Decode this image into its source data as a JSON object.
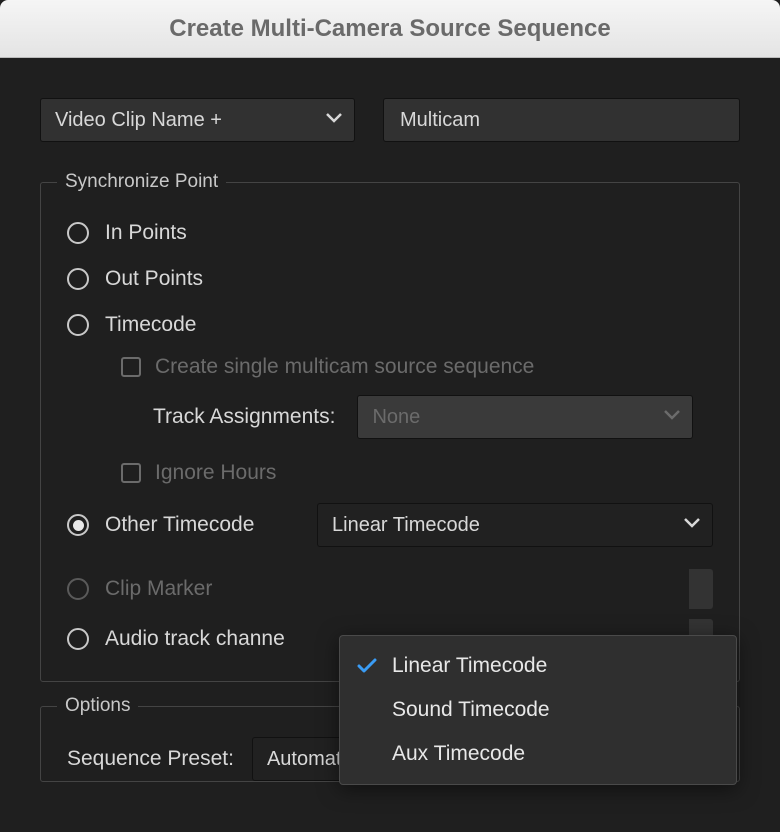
{
  "dialog": {
    "title": "Create Multi-Camera Source Sequence"
  },
  "top": {
    "video_clip_name": "Video Clip Name +",
    "multicam": "Multicam"
  },
  "sync": {
    "legend": "Synchronize Point",
    "in_points": "In Points",
    "out_points": "Out Points",
    "timecode": "Timecode",
    "create_single": "Create single multicam source sequence",
    "track_assignments_label": "Track Assignments:",
    "track_assignments_value": "None",
    "ignore_hours": "Ignore Hours",
    "other_timecode": "Other Timecode",
    "other_timecode_value": "Linear Timecode",
    "clip_marker": "Clip Marker",
    "audio_track_channel": "Audio track channe"
  },
  "popup": {
    "items": [
      {
        "label": "Linear Timecode",
        "checked": true
      },
      {
        "label": "Sound Timecode",
        "checked": false
      },
      {
        "label": "Aux Timecode",
        "checked": false
      }
    ]
  },
  "options": {
    "legend": "Options",
    "sequence_preset_label": "Sequence Preset:",
    "sequence_preset_value": "Automatic"
  }
}
